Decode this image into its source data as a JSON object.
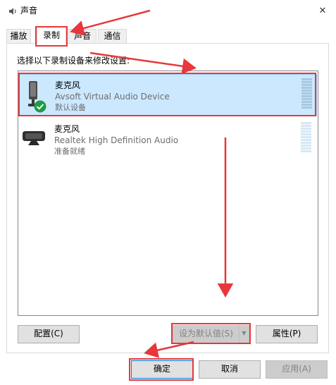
{
  "window": {
    "title": "声音",
    "close_glyph": "✕",
    "icon": "speaker-icon"
  },
  "tabs": [
    {
      "label": "播放",
      "active": false
    },
    {
      "label": "录制",
      "active": true
    },
    {
      "label": "声音",
      "active": false
    },
    {
      "label": "通信",
      "active": false
    }
  ],
  "instruction": "选择以下录制设备来修改设置:",
  "devices": [
    {
      "name": "麦克风",
      "description": "Avsoft Virtual Audio Device",
      "status": "默认设备",
      "selected": true,
      "icon": "microphone-icon",
      "badge": "default-check-icon"
    },
    {
      "name": "麦克风",
      "description": "Realtek High Definition Audio",
      "status": "准备就绪",
      "selected": false,
      "icon": "webcam-microphone-icon"
    }
  ],
  "buttons": {
    "configure": "配置(C)",
    "set_default": "设为默认值(S)",
    "set_default_arrow": "▼",
    "properties": "属性(P)",
    "ok": "确定",
    "cancel": "取消",
    "apply": "应用(A)"
  },
  "colors": {
    "selection_bg": "#cce8ff",
    "annotation_red": "#e8373a",
    "ok_border": "#0078d7",
    "check_green": "#1e9b45"
  }
}
